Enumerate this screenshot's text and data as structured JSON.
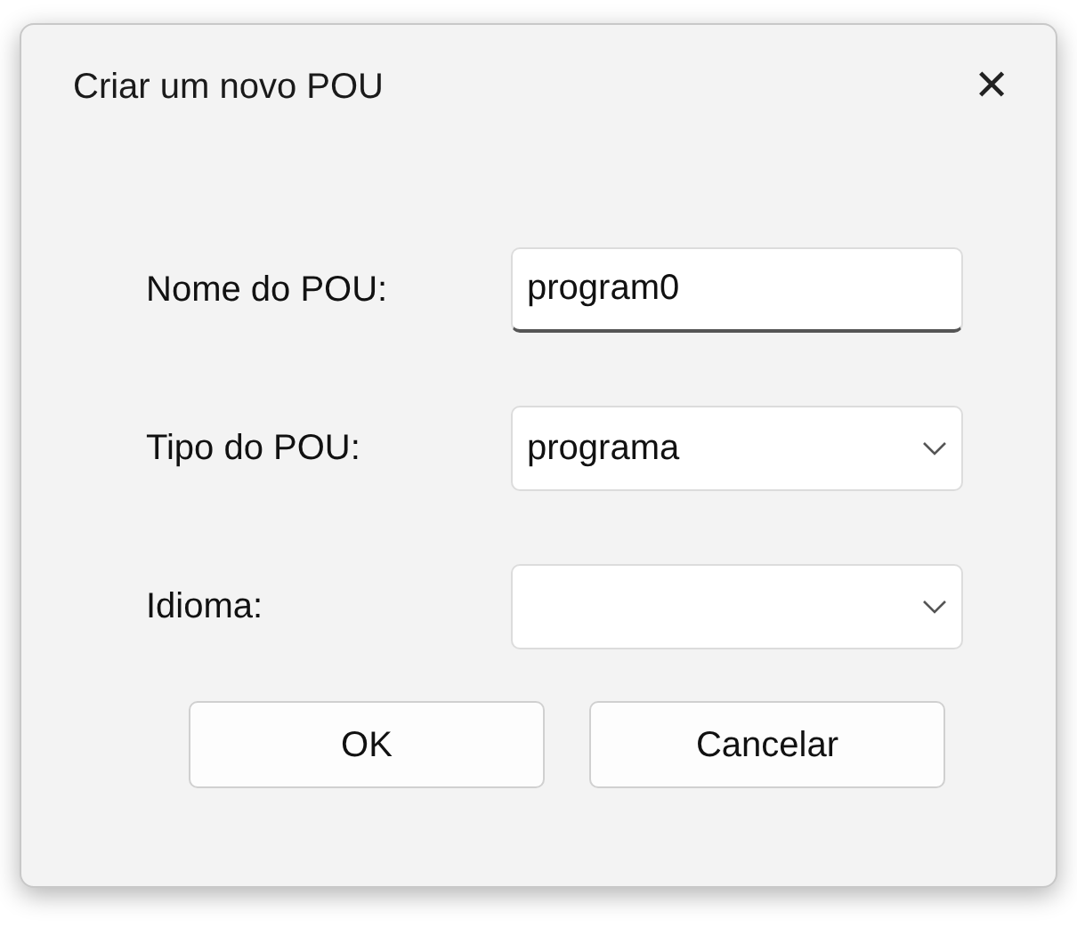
{
  "window": {
    "title": "Criar um novo POU",
    "close": "✕"
  },
  "fields": [
    {
      "kind": "text",
      "label": "Nome do POU:",
      "value": "program0",
      "focused": true
    },
    {
      "kind": "combo",
      "label": "Tipo do POU:",
      "value": "programa",
      "focused": false
    },
    {
      "kind": "combo",
      "label": "Idioma:",
      "focused": false
    }
  ],
  "buttons": [
    "OK",
    "Cancelar"
  ]
}
